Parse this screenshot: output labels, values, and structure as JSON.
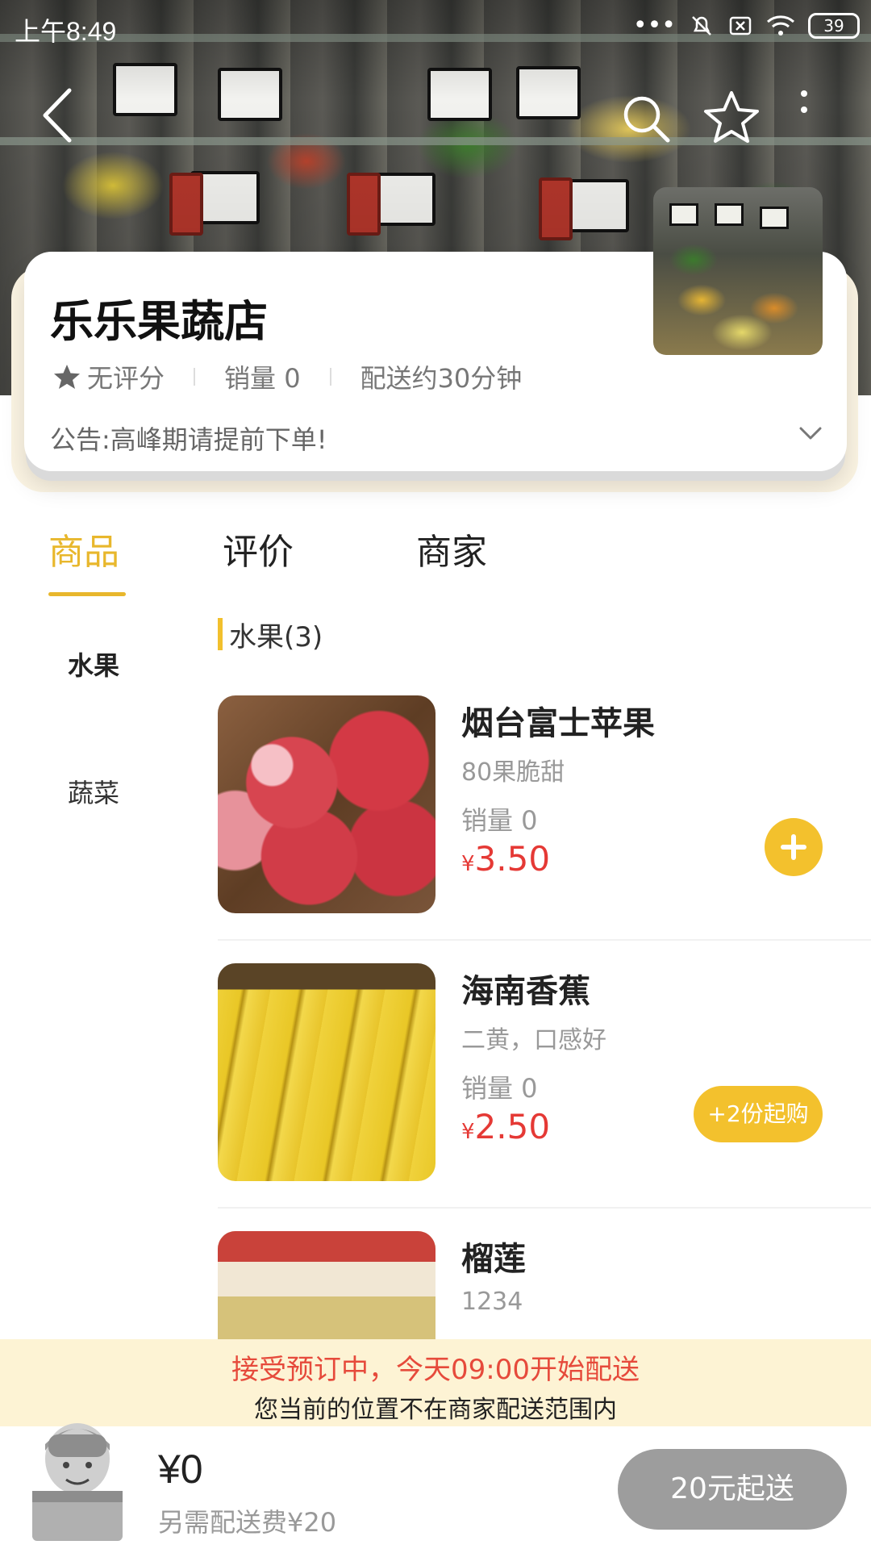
{
  "status_bar": {
    "time": "上午8:49",
    "battery": "39"
  },
  "store": {
    "name": "乐乐果蔬店",
    "rating": "无评分",
    "sales": "销量 0",
    "delivery_time": "配送约30分钟",
    "notice": "公告:高峰期请提前下单!"
  },
  "tabs": [
    {
      "label": "商品"
    },
    {
      "label": "评价"
    },
    {
      "label": "商家"
    }
  ],
  "categories": [
    {
      "label": "水果"
    },
    {
      "label": "蔬菜"
    }
  ],
  "section": {
    "title": "水果(3)"
  },
  "products": [
    {
      "name": "烟台富士苹果",
      "desc": "80果脆甜",
      "sales": "销量 0",
      "currency": "¥",
      "price": "3.50"
    },
    {
      "name": "海南香蕉",
      "desc": "二黄，口感好",
      "sales": "销量 0",
      "currency": "¥",
      "price": "2.50",
      "min_label": "+2份起购"
    },
    {
      "name": "榴莲",
      "desc": "1234"
    }
  ],
  "banner": {
    "title": "接受预订中，今天09:00开始配送",
    "subtitle": "您当前的位置不在商家配送范围内"
  },
  "cart": {
    "total": "¥0",
    "fee": "另需配送费¥20",
    "checkout_label": "20元起送"
  },
  "colors": {
    "accent": "#f3c12d",
    "price": "#e53935",
    "checkout_disabled": "#9d9d9d"
  }
}
